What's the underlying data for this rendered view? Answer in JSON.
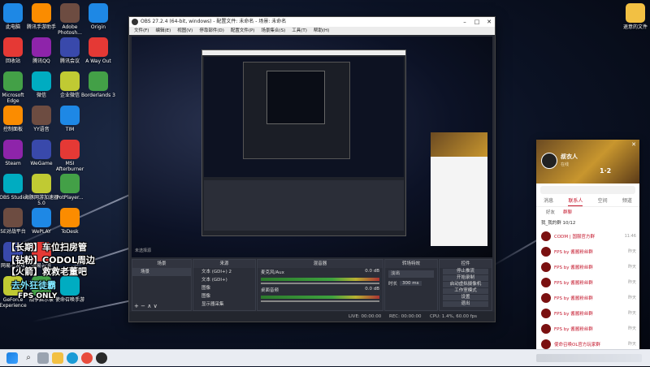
{
  "desktop": {
    "icons_col1": [
      "此电脑",
      "回收站",
      "Microsoft Edge",
      "控制面板",
      "Steam",
      "OBS Studio",
      "5E对战平台",
      "网易云游戏",
      "GeForce Experience"
    ],
    "icons_col2": [
      "腾讯手游助手",
      "腾讯QQ",
      "微信",
      "YY语音",
      "WeGame",
      "海豚网游加速器5.0",
      "WePLAY",
      "网易云游",
      "战争启示录"
    ],
    "icons_col3": [
      "Adobe Photosh...",
      "腾讯会议",
      "企业微信",
      "TIM",
      "MSI Afterburner",
      "PotPlayer...",
      "ToDesk",
      "",
      "使命召唤手游"
    ],
    "icons_col4": [
      "Origin",
      "A Way Out",
      "Borderlands 3"
    ],
    "right_icon": "退意的文件",
    "overlay_lines": [
      "【长期】车位扫房管",
      "【钻粉】CODOL周边",
      "【火箭】救救老董吧",
      "去外狂徒霸",
      "FPS ONLY"
    ]
  },
  "obs": {
    "title": "OBS 27.2.4 (64-bit, windows) - 配置文件: 未命名 - 场景: 未命名",
    "menu": [
      "文件(F)",
      "编辑(E)",
      "视图(V)",
      "停靠部件(D)",
      "配置文件(P)",
      "场景集合(S)",
      "工具(T)",
      "帮助(H)"
    ],
    "preview_note": "未选择源",
    "panels": {
      "scenes": "场景",
      "sources": "来源",
      "mixer": "混音器",
      "transitions": "转场特效",
      "controls": "控件"
    },
    "scene_item": "场景",
    "source_items": [
      "文本 (GDI+) 2",
      "文本 (GDI+)",
      "图像",
      "图像",
      "显示器采集"
    ],
    "mixer_channels": [
      {
        "name": "麦克风/Aux",
        "db": "0.0 dB"
      },
      {
        "name": "桌面音频",
        "db": "0.0 dB"
      }
    ],
    "transition": {
      "type": "淡出",
      "duration_label": "时长",
      "duration": "300 ms"
    },
    "controls": [
      "停止推流",
      "开始录制",
      "启动虚拟摄像机",
      "工作室模式",
      "设置",
      "退出"
    ],
    "status": {
      "live": "LIVE: 00:00:00",
      "rec": "REC: 00:00:00",
      "cpu": "CPU: 1.4%, 60.00 fps"
    }
  },
  "qq": {
    "username": "叔衣人",
    "subtitle": "在线",
    "badge": "1·2",
    "tabs": [
      "消息",
      "联系人",
      "空间",
      "频道"
    ],
    "active_tab": "联系人",
    "subtabs": [
      "好友",
      "群聊"
    ],
    "group_header": "我_我的群 10/12",
    "contacts": [
      {
        "name": "CODM | 国服官方群",
        "time": "11:46"
      },
      {
        "name": "FPS by 酱酱粉丝群",
        "time": "昨天"
      },
      {
        "name": "FPS by 酱酱粉丝群",
        "time": "昨天"
      },
      {
        "name": "FPS by 酱酱粉丝群",
        "time": "昨天"
      },
      {
        "name": "FPS by 酱酱粉丝群",
        "time": "昨天"
      },
      {
        "name": "FPS by 酱酱粉丝群",
        "time": "昨天"
      },
      {
        "name": "FPS by 酱酱粉丝群",
        "time": "昨天"
      },
      {
        "name": "使命召唤OL官方玩家群",
        "time": "昨天"
      },
      {
        "name": "FPS by 酱酱粉丝群",
        "time": "昨天"
      }
    ]
  },
  "colors": {
    "obs_bg": "#272a33",
    "qq_accent": "#c4162b",
    "taskbar": "#e9ecf2"
  }
}
